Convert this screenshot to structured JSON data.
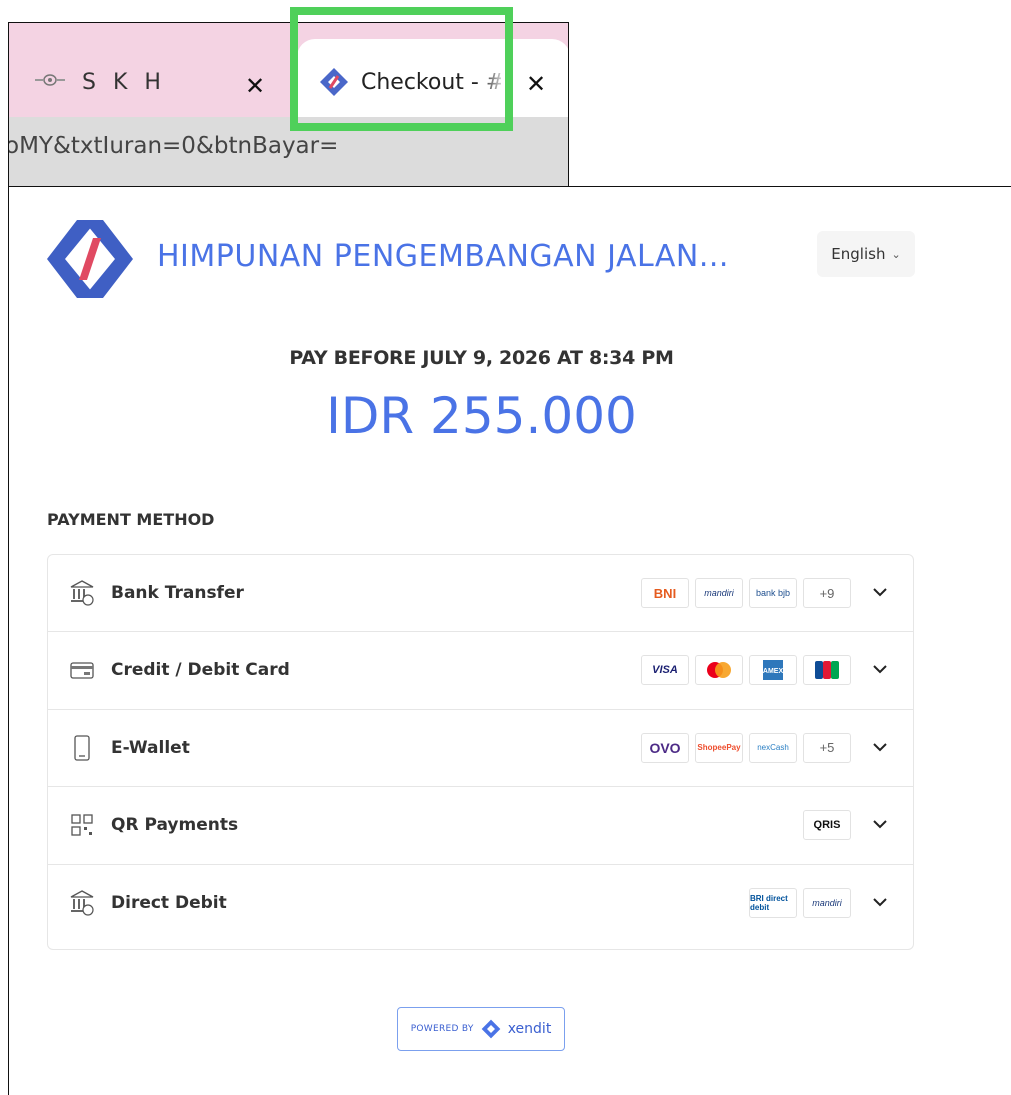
{
  "browser": {
    "inactive_tab": {
      "title": "S K H"
    },
    "active_tab": {
      "title": "Checkout - #"
    },
    "close_glyph": "✕",
    "address_bar": {
      "url": "oMY&txtIuran=0&btnBayar="
    }
  },
  "header": {
    "merchant_name": "HIMPUNAN PENGEMBANGAN JALAN...",
    "language": {
      "selected": "English",
      "chevron": "⌄"
    }
  },
  "payment": {
    "pay_before": "PAY BEFORE JULY 9, 2026 AT 8:34 PM",
    "amount": "IDR 255.000"
  },
  "payment_methods": {
    "title": "PAYMENT METHOD",
    "items": [
      {
        "label": "Bank Transfer",
        "icon": "bank-icon",
        "logos": [
          "BNI",
          "mandiri",
          "bank bjb"
        ],
        "more": "+9"
      },
      {
        "label": "Credit / Debit Card",
        "icon": "credit-card-icon",
        "logos": [
          "VISA",
          "mastercard",
          "AMEX",
          "JCB"
        ],
        "more": ""
      },
      {
        "label": "E-Wallet",
        "icon": "mobile-phone-icon",
        "logos": [
          "OVO",
          "ShopeePay",
          "nexCash"
        ],
        "more": "+5"
      },
      {
        "label": "QR Payments",
        "icon": "qr-code-icon",
        "logos": [
          "QRIS"
        ],
        "more": ""
      },
      {
        "label": "Direct Debit",
        "icon": "bank-icon",
        "logos": [
          "BRI direct debit",
          "mandiri"
        ],
        "more": ""
      }
    ]
  },
  "footer": {
    "powered_by": "POWERED BY",
    "brand": "xendit"
  },
  "colors": {
    "accent": "#4a73e6",
    "tab_strip": "#f4d3e3",
    "highlight": "#4fd05a"
  }
}
